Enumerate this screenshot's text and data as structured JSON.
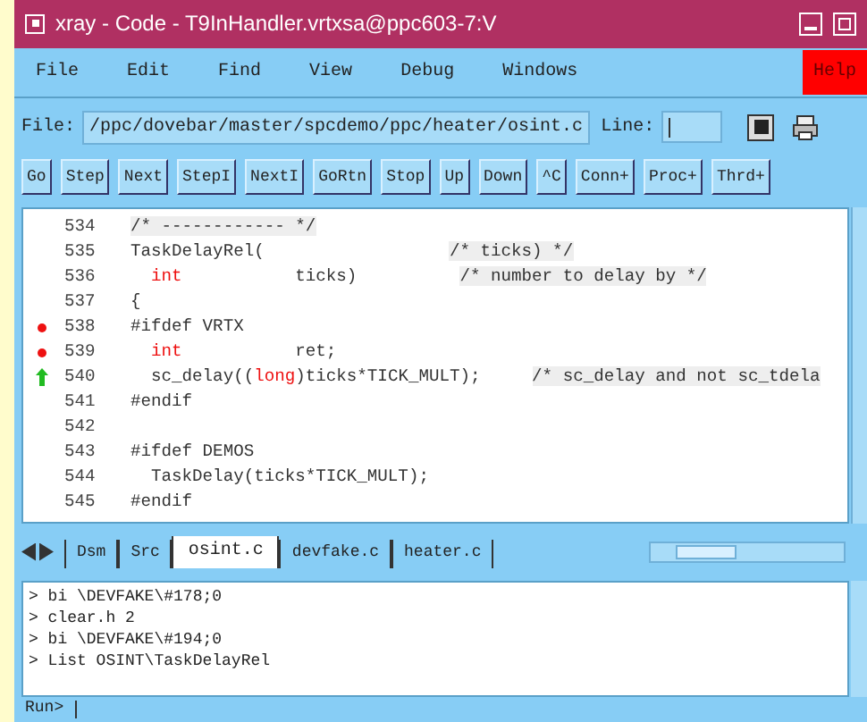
{
  "window": {
    "title": "xray - Code - T9InHandler.vrtxsa@ppc603-7:V"
  },
  "menu": [
    {
      "label": "File",
      "highlighted": false
    },
    {
      "label": "Edit",
      "highlighted": false
    },
    {
      "label": "Find",
      "highlighted": false
    },
    {
      "label": "View",
      "highlighted": false
    },
    {
      "label": "Debug",
      "highlighted": false
    },
    {
      "label": "Windows",
      "highlighted": false
    },
    {
      "label": "Help",
      "highlighted": true
    }
  ],
  "file_row": {
    "label": "File:",
    "value": "/ppc/dovebar/master/spcdemo/ppc/heater/osint.c",
    "line_label": "Line:"
  },
  "buttons": [
    "Go",
    "Step",
    "Next",
    "StepI",
    "NextI",
    "GoRtn",
    "Stop",
    "Up",
    "Down",
    "^C",
    "Conn+",
    "Proc+",
    "Thrd+"
  ],
  "code": [
    {
      "number": "534",
      "breakpoint": false,
      "current": false,
      "segments": [
        {
          "text": "/* ------------ */",
          "kind": "comment"
        }
      ]
    },
    {
      "number": "535",
      "breakpoint": false,
      "current": false,
      "segments": [
        {
          "text": "TaskDelayRel(                  ",
          "kind": "plain"
        },
        {
          "text": "/* ticks) */",
          "kind": "comment"
        }
      ]
    },
    {
      "number": "536",
      "breakpoint": false,
      "current": false,
      "segments": [
        {
          "text": "  int",
          "kind": "keyword"
        },
        {
          "text": "           ticks)          ",
          "kind": "plain"
        },
        {
          "text": "/* number to delay by */",
          "kind": "comment"
        }
      ]
    },
    {
      "number": "537",
      "breakpoint": false,
      "current": false,
      "segments": [
        {
          "text": "{",
          "kind": "plain"
        }
      ]
    },
    {
      "number": "538",
      "breakpoint": true,
      "current": false,
      "segments": [
        {
          "text": "#ifdef VRTX",
          "kind": "plain"
        }
      ]
    },
    {
      "number": "539",
      "breakpoint": true,
      "current": false,
      "segments": [
        {
          "text": "  int",
          "kind": "keyword"
        },
        {
          "text": "           ret;",
          "kind": "plain"
        }
      ]
    },
    {
      "number": "540",
      "breakpoint": false,
      "current": true,
      "segments": [
        {
          "text": "  sc_delay((",
          "kind": "plain"
        },
        {
          "text": "long",
          "kind": "keyword"
        },
        {
          "text": ")ticks*TICK_MULT);     ",
          "kind": "plain"
        },
        {
          "text": "/* sc_delay and not sc_tdela",
          "kind": "comment"
        }
      ]
    },
    {
      "number": "541",
      "breakpoint": false,
      "current": false,
      "segments": [
        {
          "text": "#endif",
          "kind": "plain"
        }
      ]
    },
    {
      "number": "542",
      "breakpoint": false,
      "current": false
    },
    {
      "number": "543",
      "breakpoint": false,
      "current": false,
      "segments": [
        {
          "text": "#ifdef DEMOS",
          "kind": "plain"
        }
      ]
    },
    {
      "number": "544",
      "breakpoint": false,
      "current": false,
      "segments": [
        {
          "text": "  TaskDelay(ticks*TICK_MULT);",
          "kind": "plain"
        }
      ]
    },
    {
      "number": "545",
      "breakpoint": false,
      "current": false,
      "segments": [
        {
          "text": "#endif",
          "kind": "plain"
        }
      ]
    }
  ],
  "tabs": [
    {
      "label": "Dsm",
      "selected": false
    },
    {
      "label": "Src",
      "selected": false
    },
    {
      "label": "osint.c",
      "selected": true
    },
    {
      "label": "devfake.c",
      "selected": false
    },
    {
      "label": "heater.c",
      "selected": false
    }
  ],
  "console": [
    "> bi \\DEVFAKE\\#178;0",
    "> clear.h 2",
    "> bi \\DEVFAKE\\#194;0",
    "> List OSINT\\TaskDelayRel"
  ],
  "prompt": "Run>"
}
